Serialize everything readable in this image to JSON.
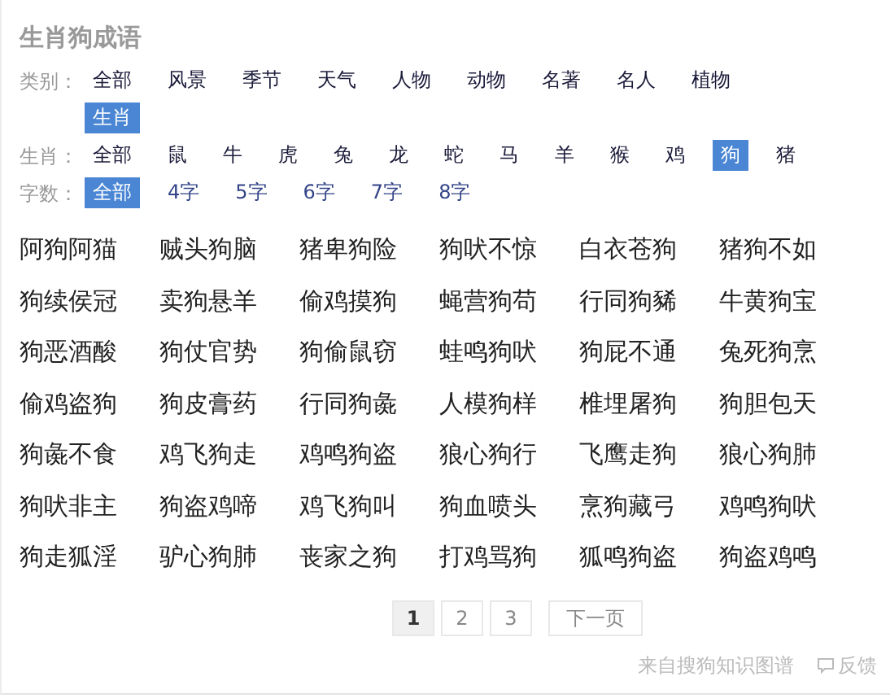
{
  "title": "生肖狗成语",
  "filters": [
    {
      "label": "类别：",
      "options": [
        {
          "text": "全部",
          "selected": false
        },
        {
          "text": "风景",
          "selected": false
        },
        {
          "text": "季节",
          "selected": false
        },
        {
          "text": "天气",
          "selected": false
        },
        {
          "text": "人物",
          "selected": false
        },
        {
          "text": "动物",
          "selected": false
        },
        {
          "text": "名著",
          "selected": false
        },
        {
          "text": "名人",
          "selected": false
        },
        {
          "text": "植物",
          "selected": false
        },
        {
          "text": "生肖",
          "selected": true
        }
      ]
    },
    {
      "label": "生肖：",
      "options": [
        {
          "text": "全部",
          "selected": false
        },
        {
          "text": "鼠",
          "selected": false
        },
        {
          "text": "牛",
          "selected": false
        },
        {
          "text": "虎",
          "selected": false
        },
        {
          "text": "兔",
          "selected": false
        },
        {
          "text": "龙",
          "selected": false
        },
        {
          "text": "蛇",
          "selected": false
        },
        {
          "text": "马",
          "selected": false
        },
        {
          "text": "羊",
          "selected": false
        },
        {
          "text": "猴",
          "selected": false
        },
        {
          "text": "鸡",
          "selected": false
        },
        {
          "text": "狗",
          "selected": true
        },
        {
          "text": "猪",
          "selected": false
        }
      ]
    },
    {
      "label": "字数：",
      "options": [
        {
          "text": "全部",
          "selected": true
        },
        {
          "text": "4字",
          "selected": false
        },
        {
          "text": "5字",
          "selected": false
        },
        {
          "text": "6字",
          "selected": false
        },
        {
          "text": "7字",
          "selected": false
        },
        {
          "text": "8字",
          "selected": false
        }
      ]
    }
  ],
  "idioms": [
    "阿狗阿猫",
    "贼头狗脑",
    "猪卑狗险",
    "狗吠不惊",
    "白衣苍狗",
    "猪狗不如",
    "狗续侯冠",
    "卖狗悬羊",
    "偷鸡摸狗",
    "蝇营狗苟",
    "行同狗豨",
    "牛黄狗宝",
    "狗恶酒酸",
    "狗仗官势",
    "狗偷鼠窃",
    "蛙鸣狗吠",
    "狗屁不通",
    "兔死狗烹",
    "偷鸡盗狗",
    "狗皮膏药",
    "行同狗彘",
    "人模狗样",
    "椎埋屠狗",
    "狗胆包天",
    "狗彘不食",
    "鸡飞狗走",
    "鸡鸣狗盗",
    "狼心狗行",
    "飞鹰走狗",
    "狼心狗肺",
    "狗吠非主",
    "狗盗鸡啼",
    "鸡飞狗叫",
    "狗血喷头",
    "烹狗藏弓",
    "鸡鸣狗吠",
    "狗走狐淫",
    "驴心狗肺",
    "丧家之狗",
    "打鸡骂狗",
    "狐鸣狗盗",
    "狗盗鸡鸣"
  ],
  "pagination": {
    "pages": [
      {
        "text": "1",
        "selected": true
      },
      {
        "text": "2",
        "selected": false
      },
      {
        "text": "3",
        "selected": false
      }
    ],
    "next": "下一页"
  },
  "footer": {
    "source": "来自搜狗知识图谱",
    "feedback": "反馈"
  }
}
